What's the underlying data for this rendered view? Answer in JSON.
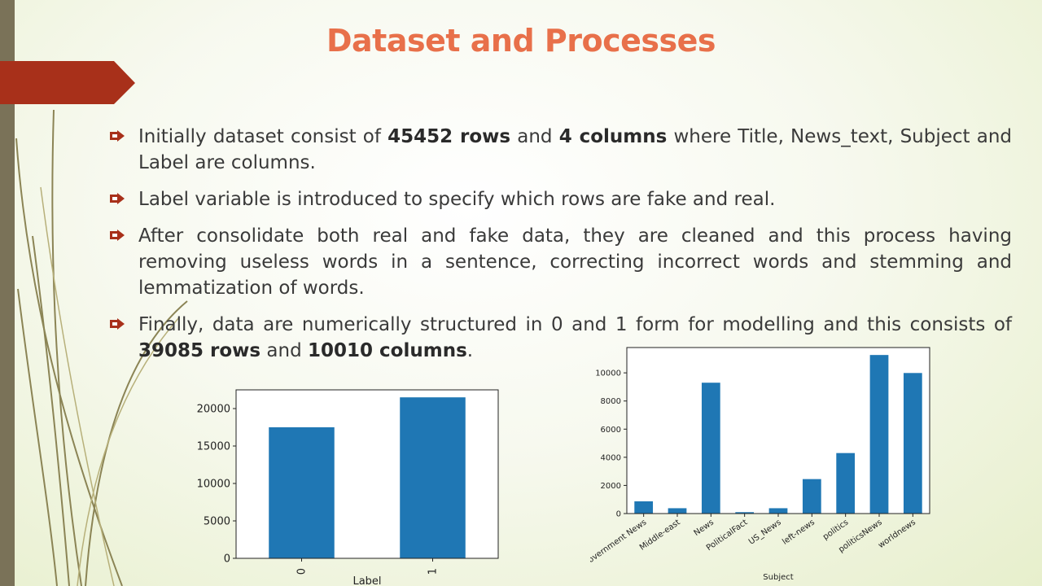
{
  "slide": {
    "title": "Dataset and Processes",
    "accent_color": "#e8704a",
    "arrow_color": "#a8301a",
    "bar_color": "#7a7258"
  },
  "bullets": [
    {
      "parts": [
        {
          "text": "Initially dataset consist of ",
          "bold": false
        },
        {
          "text": "45452 rows",
          "bold": true
        },
        {
          "text": " and ",
          "bold": false
        },
        {
          "text": "4 columns",
          "bold": true
        },
        {
          "text": " where Title, News_text, Subject and Label are columns.",
          "bold": false
        }
      ]
    },
    {
      "parts": [
        {
          "text": "Label variable is introduced to specify which rows are fake and real.",
          "bold": false
        }
      ]
    },
    {
      "parts": [
        {
          "text": "After consolidate both real and fake data, they are cleaned and this process having removing useless words in a sentence, correcting incorrect words and stemming and lemmatization of words.",
          "bold": false
        }
      ]
    },
    {
      "parts": [
        {
          "text": "Finally, data  are numerically structured in 0 and 1 form for modelling and this consists of ",
          "bold": false
        },
        {
          "text": "39085 rows",
          "bold": true
        },
        {
          "text": " and ",
          "bold": false
        },
        {
          "text": "10010 columns",
          "bold": true
        },
        {
          "text": ".",
          "bold": false
        }
      ]
    }
  ],
  "chart_data": [
    {
      "type": "bar",
      "categories": [
        "0",
        "1"
      ],
      "values": [
        17500,
        21500
      ],
      "xlabel": "Label",
      "ylabel": "",
      "ylim": [
        0,
        22500
      ],
      "yticks": [
        0,
        5000,
        10000,
        15000,
        20000
      ],
      "ytick_labels": [
        "0",
        "5000",
        "10000",
        "15000",
        "20000"
      ],
      "bar_color": "#1f77b4",
      "grid": false
    },
    {
      "type": "bar",
      "categories": [
        "Government News",
        "Middle-east",
        "News",
        "PoliticalFact",
        "US_News",
        "left-news",
        "politics",
        "politicsNews",
        "worldnews"
      ],
      "values": [
        870,
        380,
        9300,
        100,
        380,
        2450,
        4300,
        11270,
        9990
      ],
      "xlabel": "Subject",
      "ylabel": "",
      "ylim": [
        0,
        11800
      ],
      "yticks": [
        0,
        2000,
        4000,
        6000,
        8000,
        10000
      ],
      "ytick_labels": [
        "0",
        "2000",
        "4000",
        "6000",
        "8000",
        "10000"
      ],
      "bar_color": "#1f77b4",
      "grid": false
    }
  ]
}
